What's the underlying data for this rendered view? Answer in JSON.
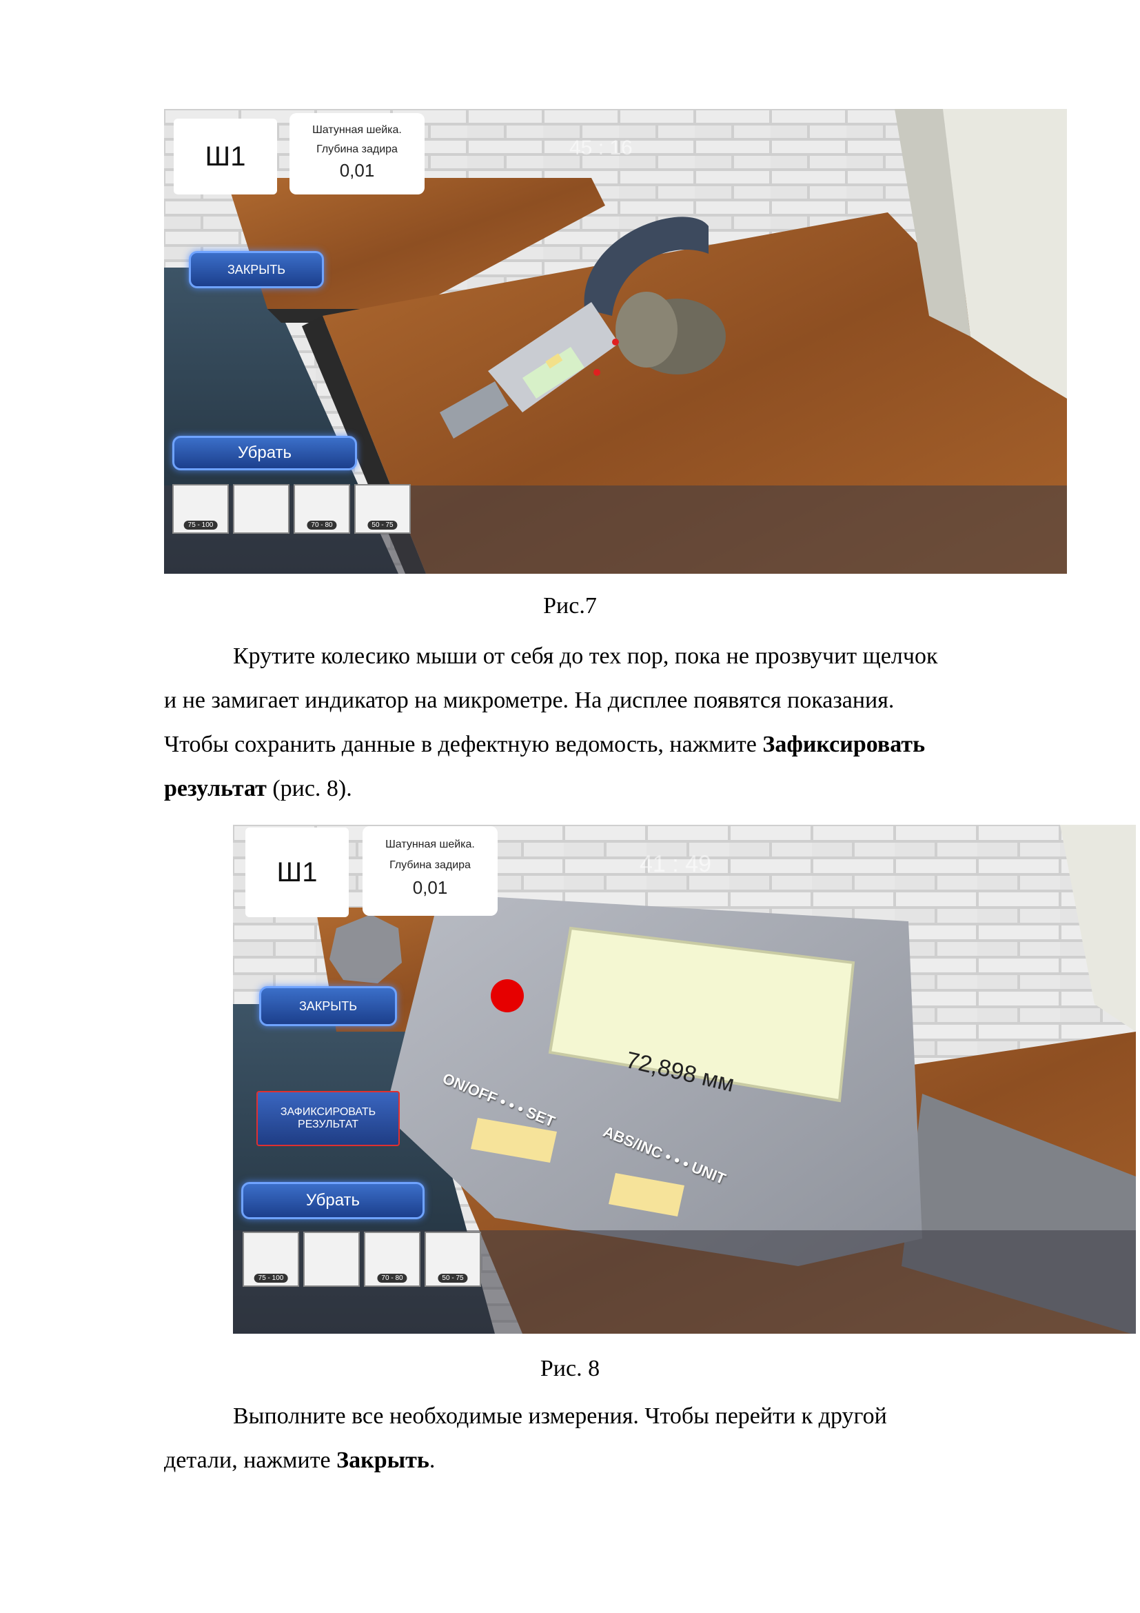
{
  "figure7": {
    "code": "Ш1",
    "info_line1": "Шатунная шейка.",
    "info_line2": "Глубина задира",
    "info_value": "0,01",
    "timer": "45 : 16",
    "close_label": "ЗАКРЫТЬ",
    "remove_label": "Убрать",
    "tools": [
      "75 - 100",
      "",
      "70 - 80",
      "50 - 75"
    ]
  },
  "caption7": "Рис.7",
  "para1": {
    "line1": "Крутите колесико мыши от себя до тех пор, пока не прозвучит щелчок",
    "line2": "и не замигает индикатор на микрометре. На дисплее появятся показания.",
    "line3a": "Чтобы сохранить данные в дефектную ведомость, нажмите ",
    "line3b": "Зафиксировать",
    "line4a": "результат",
    "line4b": " (рис. 8)."
  },
  "figure8": {
    "code": "Ш1",
    "info_line1": "Шатунная шейка.",
    "info_line2": "Глубина задира",
    "info_value": "0,01",
    "timer": "41 : 49",
    "close_label": "ЗАКРЫТЬ",
    "fix_line1": "ЗАФИКСИРОВАТЬ",
    "fix_line2": "РЕЗУЛЬТАТ",
    "remove_label": "Убрать",
    "display_value": "72,898 мм",
    "onoff_label": "ON/OFF",
    "set_label": "SET",
    "abs_label": "ABS/INC",
    "unit_label": "UNIT",
    "tools": [
      "75 - 100",
      "",
      "70 - 80",
      "50 - 75"
    ]
  },
  "caption8": "Рис. 8",
  "para2": {
    "line1": "Выполните все необходимые измерения. Чтобы перейти к другой",
    "line2a": "детали, нажмите ",
    "line2b": "Закрыть",
    "line2c": "."
  },
  "colors": {
    "wood": "#9a5a2a",
    "brick": "#e6e6e6",
    "button_blue": "#2a55ad",
    "highlight_red": "#e03030"
  }
}
